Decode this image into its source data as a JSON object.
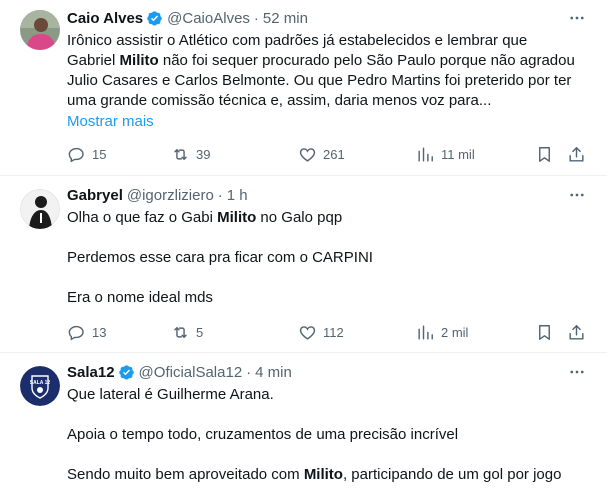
{
  "tweets": [
    {
      "name": "Caio Alves",
      "handle": "@CaioAlves",
      "time": "52 min",
      "lines": [
        [
          "Irônico assistir o Atlético com padrões já estabelecidos e lembrar que"
        ],
        [
          "Gabriel ",
          "Milito",
          " não foi sequer procurado pelo São Paulo porque não agradou"
        ],
        [
          "Julio Casares e Carlos Belmonte. Ou que Pedro Martins foi preterido por ter"
        ],
        [
          "uma grande comissão técnica e, assim, daria menos voz para..."
        ]
      ],
      "show_more": "Mostrar mais",
      "replies": "15",
      "retweets": "39",
      "likes": "261",
      "views": "11 mil",
      "verified": true
    },
    {
      "name": "Gabryel",
      "handle": "@igorzliziero",
      "time": "1 h",
      "lines": [
        [
          "Olha o que faz o Gabi ",
          "Milito",
          " no Galo pqp"
        ],
        [
          "Perdemos esse cara pra ficar com o CARPINI"
        ],
        [
          "Era o nome ideal mds"
        ]
      ],
      "replies": "13",
      "retweets": "5",
      "likes": "112",
      "views": "2 mil",
      "verified": false
    },
    {
      "name": "Sala12",
      "handle": "@OficialSala12",
      "time": "4 min",
      "lines": [
        [
          "Que lateral é Guilherme Arana."
        ],
        [
          "Apoia o tempo todo, cruzamentos de uma precisão incrível"
        ],
        [
          "Sendo muito bem aproveitado com ",
          "Milito",
          ", participando de um gol por jogo"
        ]
      ],
      "verified": true
    }
  ],
  "avatar3_badge": "SALA 12",
  "colors": {
    "text": "#0f1419",
    "muted": "#536471",
    "link": "#1d9bf0",
    "verified": "#1d9bf0",
    "divider": "#eff3f4"
  },
  "icons": [
    "verified-badge-icon",
    "more-options-icon",
    "reply-icon",
    "retweet-icon",
    "like-icon",
    "views-icon",
    "bookmark-icon",
    "share-icon"
  ]
}
